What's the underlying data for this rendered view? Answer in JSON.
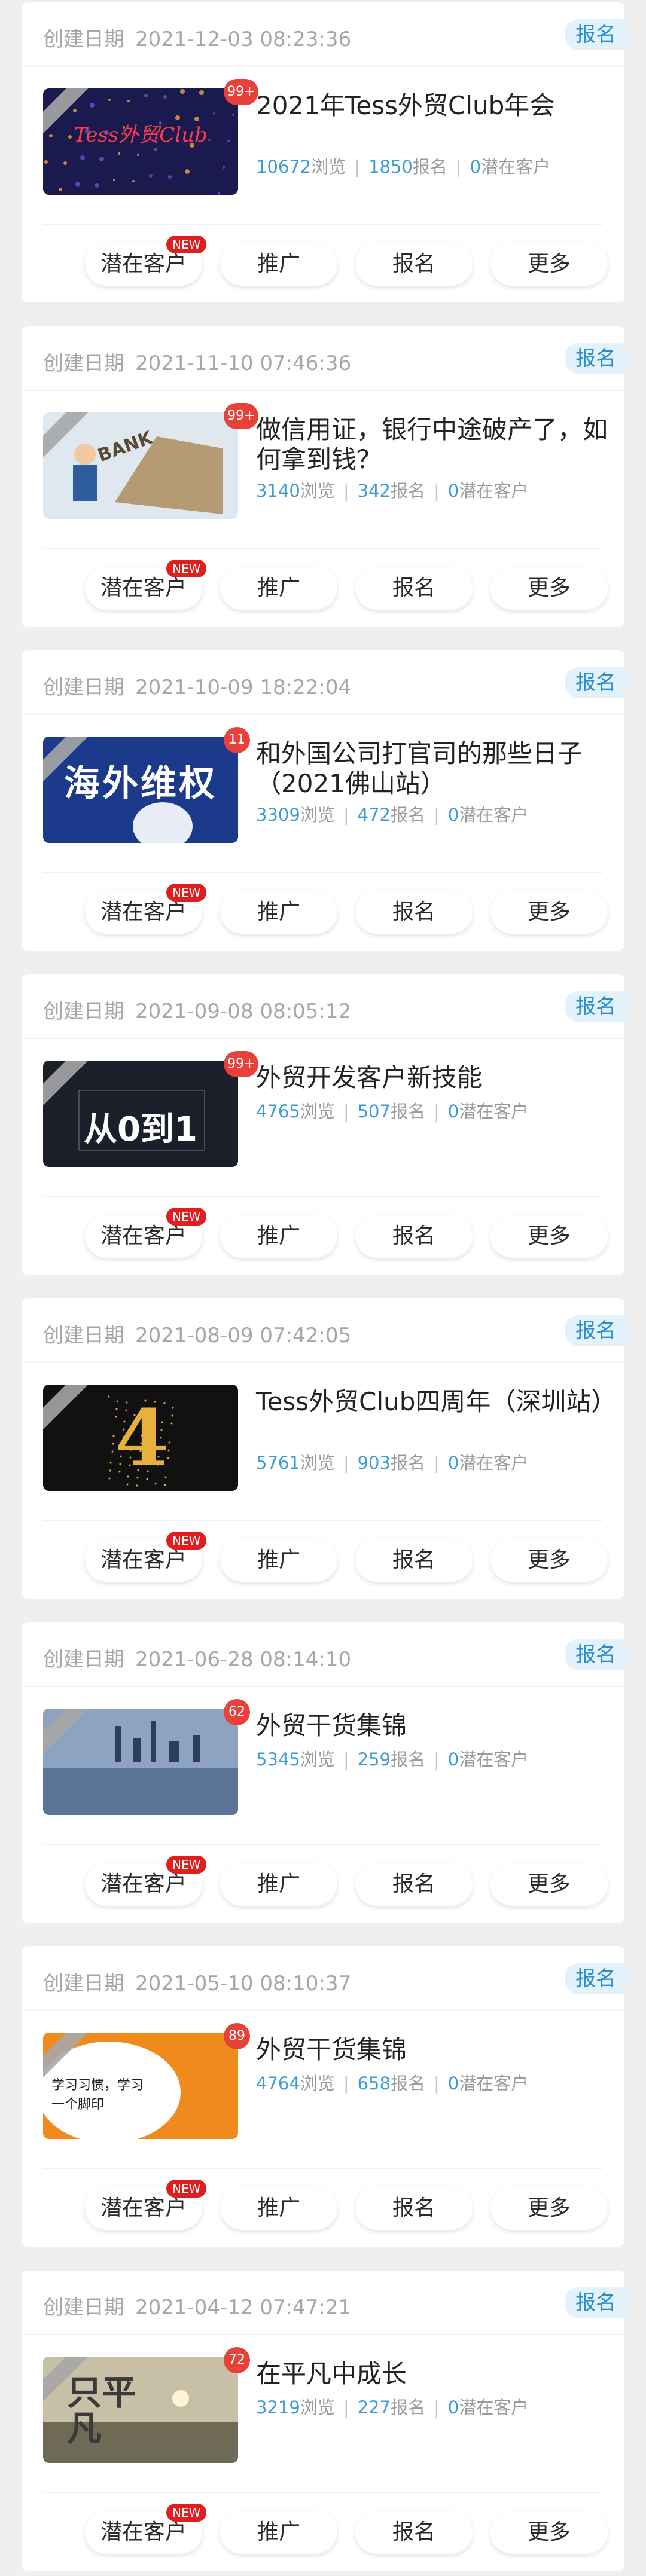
{
  "labels": {
    "date_label": "创建日期",
    "tag": "报名",
    "views_suffix": "浏览",
    "signups_suffix": "报名",
    "prospects_suffix": "潜在客户",
    "new_badge": "NEW",
    "buttons": [
      "潜在客户",
      "推广",
      "报名",
      "更多"
    ]
  },
  "events": [
    {
      "date": "2021-12-03 08:23:36",
      "title": "2021年Tess外贸Club年会",
      "views": "10672",
      "signups": "1850",
      "prospects": "0",
      "badge": "99+",
      "thumb_text": "Tess外贸Club",
      "thumb_bg": "#1a1a4e"
    },
    {
      "date": "2021-11-10 07:46:36",
      "title": "做信用证，银行中途破产了，如何拿到钱？",
      "views": "3140",
      "signups": "342",
      "prospects": "0",
      "badge": "99+",
      "thumb_text": "BANK",
      "thumb_bg": "#dfe7ef"
    },
    {
      "date": "2021-10-09 18:22:04",
      "title": "和外国公司打官司的那些日子（2021佛山站）",
      "views": "3309",
      "signups": "472",
      "prospects": "0",
      "badge": "11",
      "thumb_text": "海外维权",
      "thumb_bg": "#1b3a8c"
    },
    {
      "date": "2021-09-08 08:05:12",
      "title": "外贸开发客户新技能",
      "views": "4765",
      "signups": "507",
      "prospects": "0",
      "badge": "99+",
      "thumb_text": "从0到1",
      "thumb_bg": "#1b1f2a"
    },
    {
      "date": "2021-08-09 07:42:05",
      "title": "Tess外贸Club四周年（深圳站）",
      "views": "5761",
      "signups": "903",
      "prospects": "0",
      "badge": "",
      "thumb_text": "4",
      "thumb_bg": "#111111"
    },
    {
      "date": "2021-06-28 08:14:10",
      "title": "外贸干货集锦",
      "views": "5345",
      "signups": "259",
      "prospects": "0",
      "badge": "62",
      "thumb_text": "",
      "thumb_bg": "#47607e"
    },
    {
      "date": "2021-05-10 08:10:37",
      "title": "外贸干货集锦",
      "views": "4764",
      "signups": "658",
      "prospects": "0",
      "badge": "89",
      "thumb_text": "学习习惯，学习一个脚印",
      "thumb_bg": "#f08a1d"
    },
    {
      "date": "2021-04-12 07:47:21",
      "title": "在平凡中成长",
      "views": "3219",
      "signups": "227",
      "prospects": "0",
      "badge": "72",
      "thumb_text": "只平 凡",
      "thumb_bg": "#6f6a55"
    }
  ]
}
